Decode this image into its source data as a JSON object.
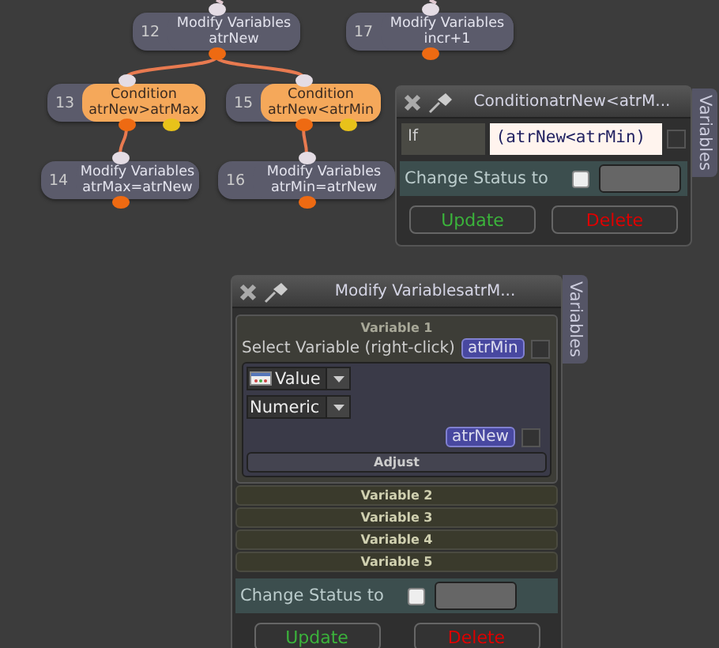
{
  "graph": {
    "nodes": [
      {
        "number": "12",
        "kind": "modify",
        "title": "Modify Variables",
        "subtitle": "atrNew",
        "children": [
          {
            "number": "13",
            "kind": "condition",
            "title": "Condition",
            "subtitle": "atrNew>atrMax",
            "children": [
              {
                "number": "14",
                "kind": "modify",
                "title": "Modify Variables",
                "subtitle": "atrMax=atrNew"
              }
            ]
          },
          {
            "number": "15",
            "kind": "condition",
            "title": "Condition",
            "subtitle": "atrNew<atrMin",
            "children": [
              {
                "number": "16",
                "kind": "modify",
                "title": "Modify Variables",
                "subtitle": "atrMin=atrNew"
              }
            ]
          }
        ]
      },
      {
        "number": "17",
        "kind": "modify",
        "title": "Modify Variables",
        "subtitle": "incr+1"
      }
    ]
  },
  "condition_panel": {
    "title": "ConditionatrNew<atrM...",
    "side_tab": "Variables",
    "if_label": "If",
    "expression": "(atrNew<atrMin)",
    "expression_checked": false,
    "change_status": {
      "label": "Change Status to",
      "checked": false
    },
    "buttons": [
      {
        "label": "Update",
        "kind": "update"
      },
      {
        "label": "Delete",
        "kind": "delete"
      }
    ]
  },
  "modify_panel": {
    "title": "Modify VariablesatrM...",
    "side_tab": "Variables",
    "sections": [
      {
        "title": "Variable 1",
        "expanded": true,
        "select_label": "Select Variable (right-click)",
        "variable": "atrMin",
        "variable_checked": false,
        "type": "Value",
        "format": "Numeric",
        "value": "atrNew",
        "value_checked": false,
        "adjust": "Adjust"
      },
      {
        "title": "Variable 2",
        "expanded": false
      },
      {
        "title": "Variable 3",
        "expanded": false
      },
      {
        "title": "Variable 4",
        "expanded": false
      },
      {
        "title": "Variable 5",
        "expanded": false
      }
    ],
    "change_status": {
      "label": "Change Status to",
      "checked": false
    },
    "buttons": [
      {
        "label": "Update",
        "kind": "update"
      },
      {
        "label": "Delete",
        "kind": "delete"
      }
    ]
  }
}
